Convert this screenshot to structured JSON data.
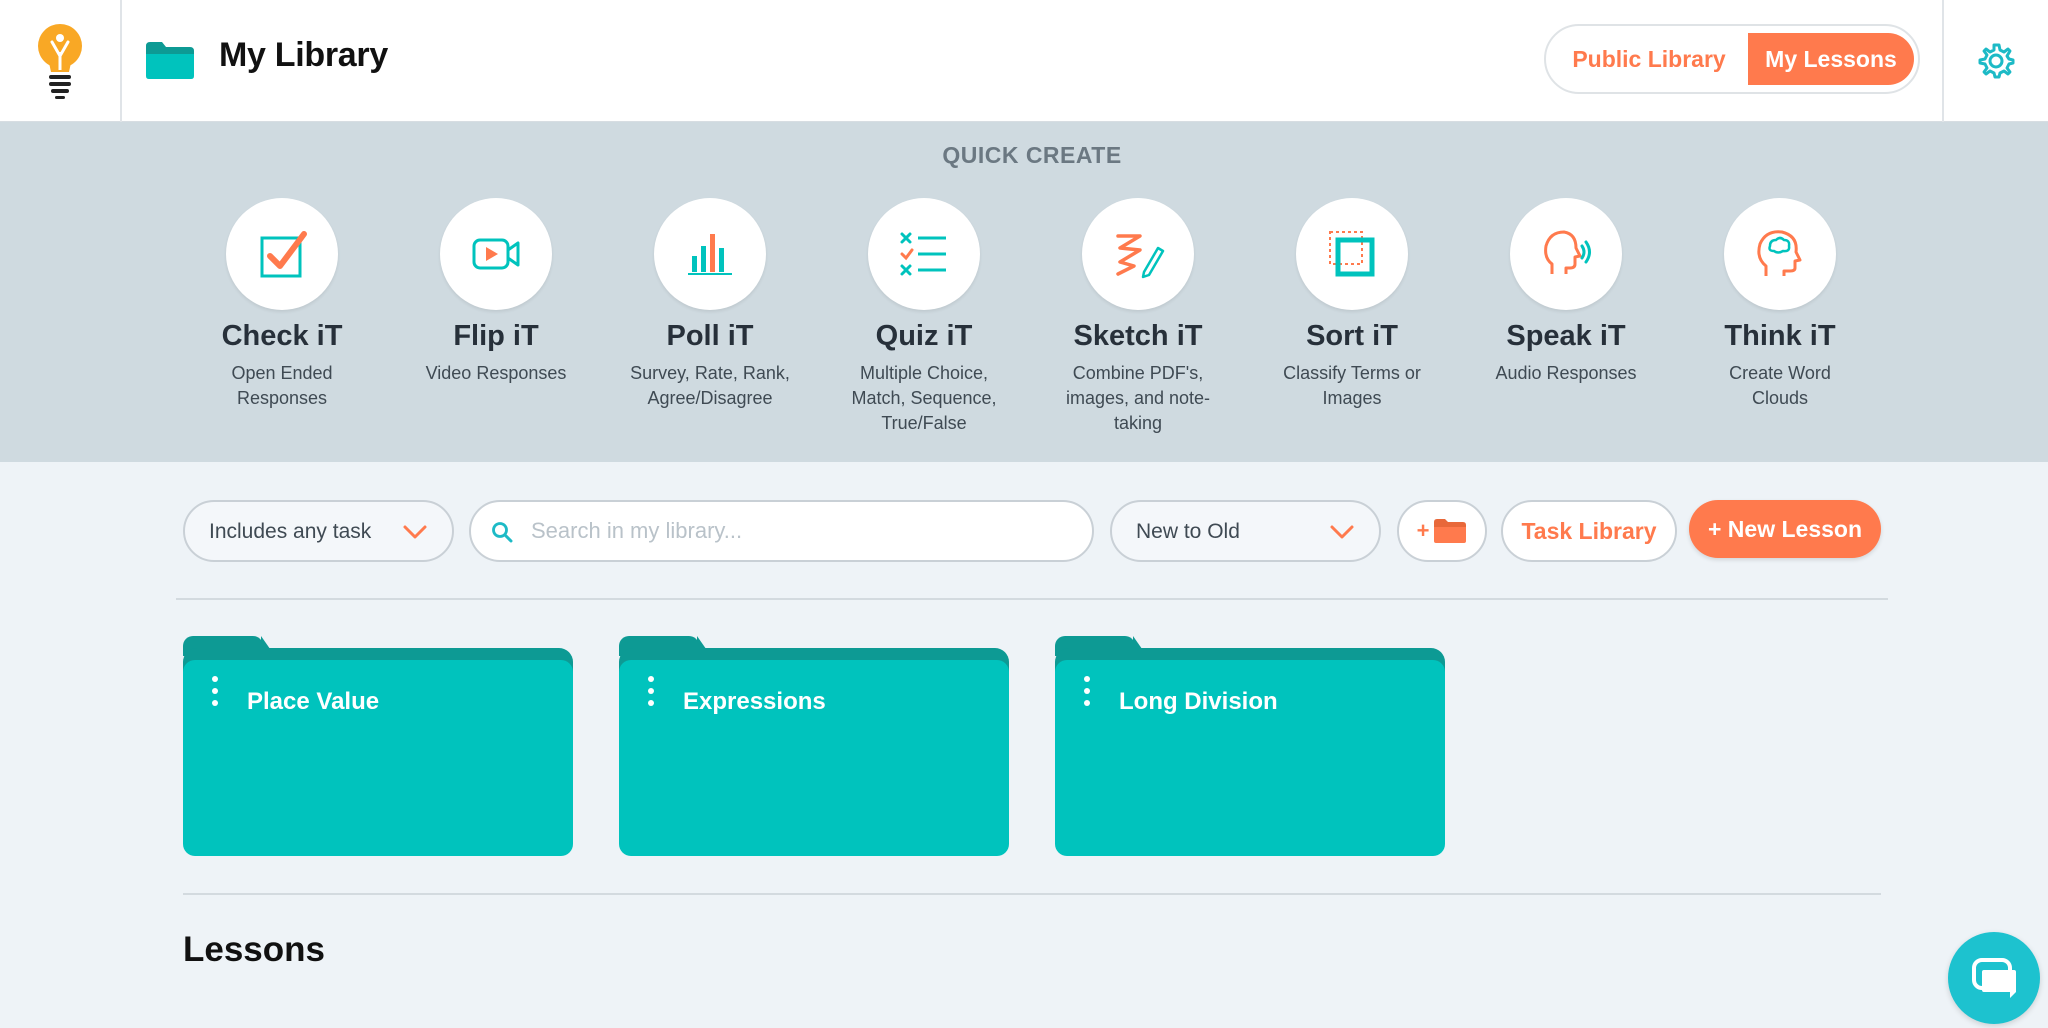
{
  "header": {
    "title": "My Library",
    "toggle": {
      "public_label": "Public Library",
      "mine_label": "My Lessons",
      "active": "My Lessons"
    }
  },
  "quick_create": {
    "heading": "QUICK CREATE",
    "items": [
      {
        "title": "Check iT",
        "desc": "Open Ended Responses",
        "icon": "checkbox-icon"
      },
      {
        "title": "Flip iT",
        "desc": "Video Responses",
        "icon": "video-camera-icon"
      },
      {
        "title": "Poll iT",
        "desc": "Survey, Rate, Rank, Agree/Disagree",
        "icon": "bar-chart-icon"
      },
      {
        "title": "Quiz iT",
        "desc": "Multiple Choice, Match, Sequence, True/False",
        "icon": "checklist-icon"
      },
      {
        "title": "Sketch iT",
        "desc": "Combine PDF's, images, and note-taking",
        "icon": "pencil-scribble-icon"
      },
      {
        "title": "Sort iT",
        "desc": "Classify Terms or Images",
        "icon": "sort-squares-icon"
      },
      {
        "title": "Speak iT",
        "desc": "Audio Responses",
        "icon": "speaking-head-icon"
      },
      {
        "title": "Think iT",
        "desc": "Create Word Clouds",
        "icon": "thinking-head-icon"
      }
    ]
  },
  "toolbar": {
    "task_filter": "Includes any task",
    "search_placeholder": "Search in my library...",
    "sort": "New to Old",
    "new_folder_label": "+",
    "task_library_label": "Task Library",
    "new_lesson_label": "+ New Lesson"
  },
  "folders": [
    {
      "name": "Place Value"
    },
    {
      "name": "Expressions"
    },
    {
      "name": "Long Division"
    }
  ],
  "lessons": {
    "heading": "Lessons"
  },
  "colors": {
    "accent": "#ff7a4d",
    "teal": "#00c3bd",
    "teal_dark": "#0d9a94",
    "quick_create_bg": "#cfdae0",
    "page_bg": "#eef3f7"
  }
}
